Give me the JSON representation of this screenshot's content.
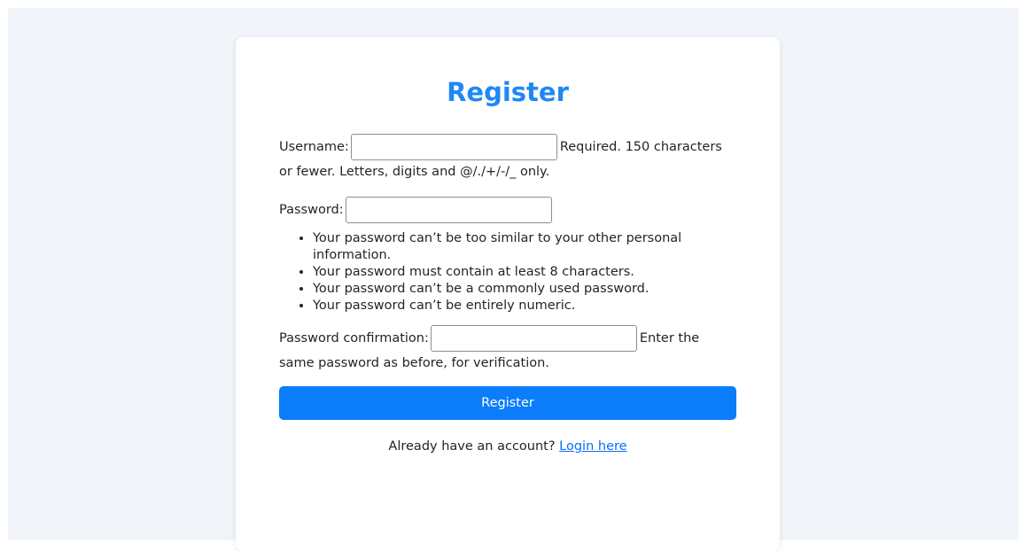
{
  "page": {
    "title": "Register"
  },
  "form": {
    "username": {
      "label": "Username:",
      "value": "",
      "help": "Required. 150 characters or fewer. Letters, digits and @/./+/-/_ only."
    },
    "password": {
      "label": "Password:",
      "value": "",
      "rules": [
        "Your password can’t be too similar to your other personal information.",
        "Your password must contain at least 8 characters.",
        "Your password can’t be a commonly used password.",
        "Your password can’t be entirely numeric."
      ]
    },
    "confirm": {
      "label": "Password confirmation:",
      "value": "",
      "help": "Enter the same password as before, for verification."
    },
    "submit_label": "Register"
  },
  "footer": {
    "prompt": "Already have an account?",
    "link_label": "Login here"
  },
  "colors": {
    "accent": "#0b7dfb",
    "title": "#1e88f5",
    "page_background": "#f1f5f9"
  }
}
